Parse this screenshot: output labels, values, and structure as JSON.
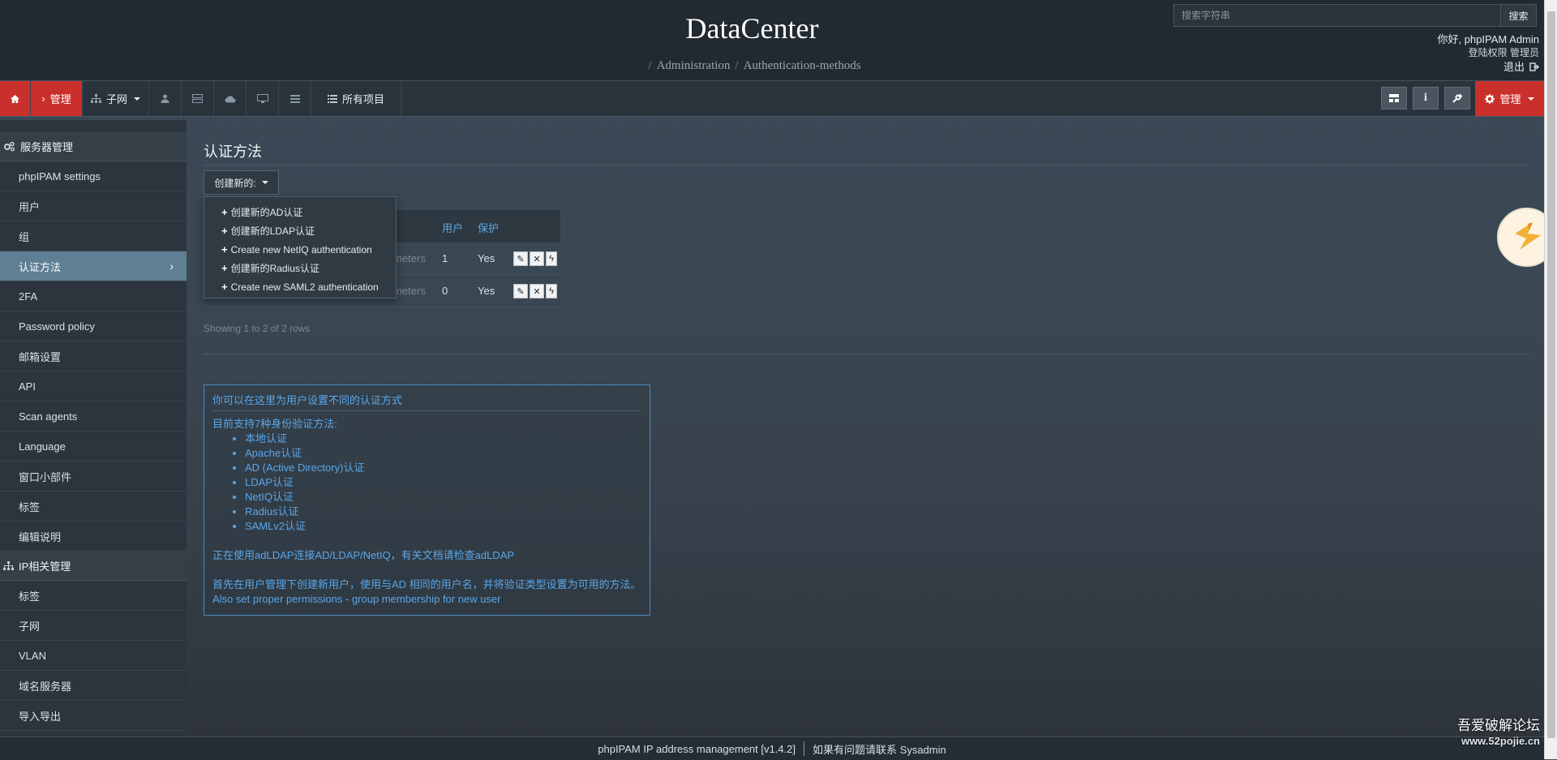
{
  "header": {
    "site_title": "DataCenter",
    "breadcrumb": [
      "Administration",
      "Authentication-methods"
    ],
    "search_placeholder": "搜索字符串",
    "search_button": "搜索",
    "user_greeting": "你好, phpIPAM Admin",
    "user_links": "登陆权限 管理员",
    "logout": "退出"
  },
  "navbar": {
    "admin_crumb": "管理",
    "subnets": "子网",
    "all_items": "所有项目",
    "admin_menu": "管理"
  },
  "sidebar": {
    "server_section": "服务器管理",
    "server_items": [
      "phpIPAM settings",
      "用户",
      "组",
      "认证方法",
      "2FA",
      "Password policy",
      "邮箱设置",
      "API",
      "Scan agents",
      "Language",
      "窗口小部件",
      "标签",
      "编辑说明"
    ],
    "ip_section": "IP相关管理",
    "ip_items": [
      "标签",
      "子网",
      "VLAN",
      "域名服务器",
      "导入导出"
    ]
  },
  "main": {
    "title": "认证方法",
    "create_button": "创建新的:",
    "dropdown_items": [
      "创建新的AD认证",
      "创建新的LDAP认证",
      "Create new NetIQ authentication",
      "创建新的Radius认证",
      "Create new SAML2 authentication"
    ],
    "table": {
      "headers": {
        "users": "用户",
        "protected": "保护"
      },
      "rows": [
        {
          "params": "meters",
          "users": "1",
          "protected": "Yes"
        },
        {
          "params": "meters",
          "users": "0",
          "protected": "Yes"
        }
      ]
    },
    "rows_info": "Showing 1 to 2 of 2 rows"
  },
  "info": {
    "title": "你可以在这里为用户设置不同的认证方式",
    "supported_intro": "目前支持7种身份验证方法:",
    "methods": [
      "本地认证",
      "Apache认证",
      "AD (Active Directory)认证",
      "LDAP认证",
      "NetIQ认证",
      "Radius认证",
      "SAMLv2认证"
    ],
    "adldap_note": "正在使用adLDAP连接AD/LDAP/NetIQ，有关文档请检查adLDAP",
    "user_note": "首先在用户管理下创建新用户，使用与AD 相同的用户名，并将验证类型设置为可用的方法。",
    "perm_note": "Also set proper permissions - group membership for new user"
  },
  "footer": {
    "version": "phpIPAM IP address management [v1.4.2]",
    "contact": "如果有问题请联系 Sysadmin"
  },
  "watermark": {
    "line1": "吾爱破解论坛",
    "line2": "www.52pojie.cn"
  },
  "colors": {
    "accent_red": "#c9302c",
    "link_blue": "#5aa6e8",
    "active_item": "#5f7f94"
  }
}
